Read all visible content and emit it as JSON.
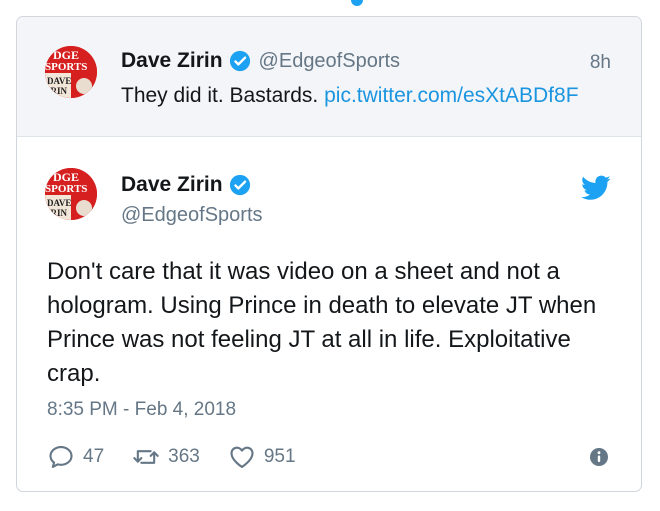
{
  "colors": {
    "accent": "#1da1f2",
    "link": "#1b95e0",
    "muted": "#657786",
    "avatar": "#d62020"
  },
  "quoted_tweet": {
    "avatar": {
      "line1": "DGE",
      "line2": "SPORTS",
      "line3": "DAVE",
      "line4": "IRIN"
    },
    "name": "Dave Zirin",
    "handle": "@EdgeofSports",
    "time": "8h",
    "text": "They did it. Bastards.",
    "link": "pic.twitter.com/esXtABDf8F"
  },
  "tweet": {
    "avatar": {
      "line1": "DGE",
      "line2": "SPORTS",
      "line3": "DAVE",
      "line4": "IRIN"
    },
    "name": "Dave Zirin",
    "handle": "@EdgeofSports",
    "text": "Don't care that it was video on a sheet and not a hologram. Using Prince in death to elevate JT when Prince was not feeling JT at all in life. Exploitative crap.",
    "timestamp": "8:35 PM - Feb 4, 2018",
    "actions": {
      "replies": "47",
      "retweets": "363",
      "likes": "951"
    }
  }
}
